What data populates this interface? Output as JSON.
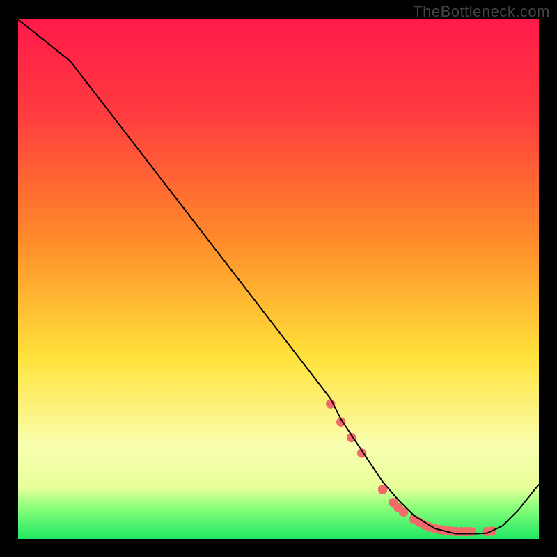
{
  "watermark": "TheBottleneck.com",
  "colors": {
    "frame": "#000000",
    "curve": "#000000",
    "dots": "#f46a6a",
    "grad_top": "#ff1a4a",
    "grad_mid_red": "#ff3b3f",
    "grad_orange": "#ff8a2a",
    "grad_yellow": "#ffe23a",
    "grad_pale": "#f9ffb0",
    "grad_green_light": "#8aff7a",
    "grad_green": "#1fe864"
  },
  "chart_data": {
    "type": "line",
    "title": "",
    "xlabel": "",
    "ylabel": "",
    "xlim": [
      0,
      100
    ],
    "ylim": [
      0,
      100
    ],
    "curve": {
      "x": [
        0,
        5,
        10,
        15,
        20,
        25,
        30,
        35,
        40,
        45,
        50,
        55,
        60,
        62,
        65,
        68,
        70,
        73,
        76,
        80,
        84,
        88,
        90,
        93,
        96,
        100
      ],
      "y": [
        100,
        96,
        92,
        85.5,
        79,
        72.5,
        66,
        59.5,
        53,
        46.5,
        40,
        33.5,
        27,
        23,
        18.5,
        14,
        11,
        7.5,
        4.5,
        2,
        1,
        1,
        1.1,
        2.5,
        5.5,
        10.5
      ]
    },
    "dots": {
      "x": [
        60,
        62,
        64,
        66,
        70,
        72,
        73,
        74,
        76,
        77,
        78,
        79,
        80,
        81,
        82,
        83,
        84,
        85,
        86,
        87,
        90,
        91
      ],
      "y": [
        26,
        22.5,
        19.5,
        16.5,
        9.5,
        7,
        6,
        5.2,
        3.8,
        3.2,
        2.7,
        2.3,
        2,
        1.8,
        1.6,
        1.5,
        1.4,
        1.4,
        1.4,
        1.4,
        1.4,
        1.5
      ]
    }
  }
}
